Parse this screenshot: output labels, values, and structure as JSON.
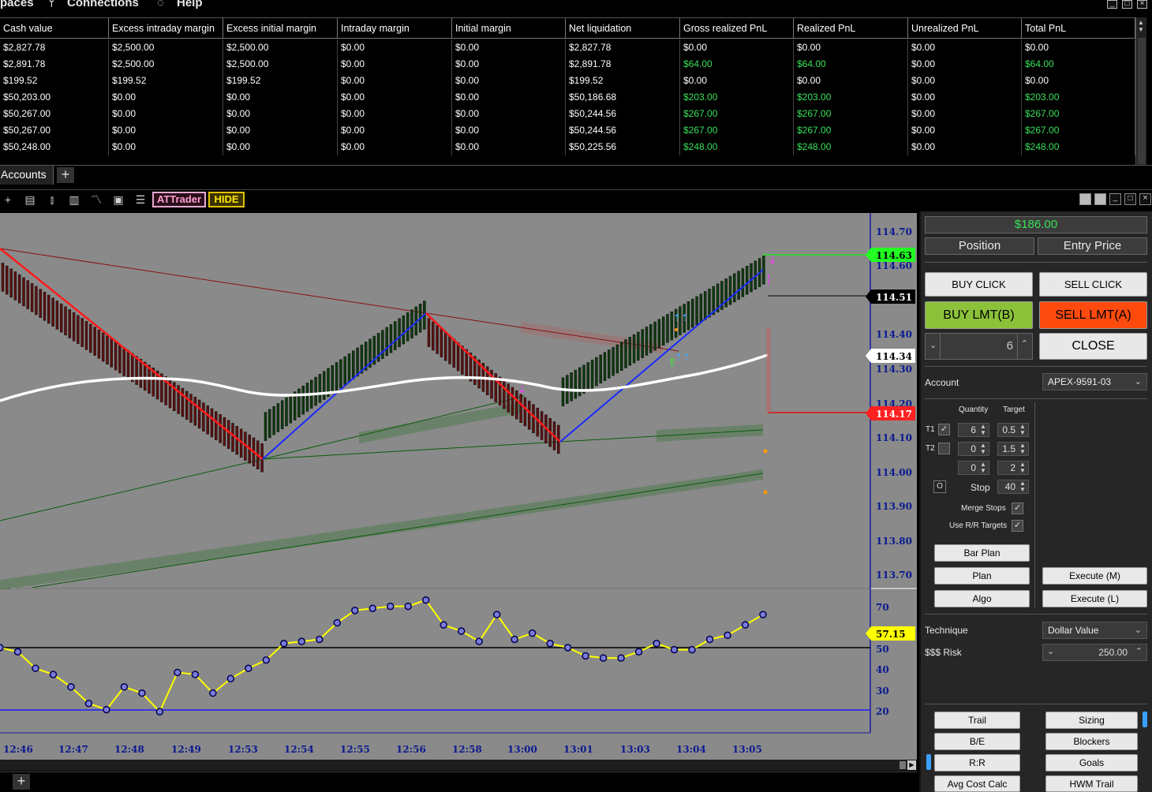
{
  "menu": {
    "items": [
      "paces",
      "Connections",
      "Help"
    ]
  },
  "grid": {
    "columns": [
      "Cash value",
      "Excess intraday margin",
      "Excess initial margin",
      "Intraday margin",
      "Initial margin",
      "Net liquidation",
      "Gross realized PnL",
      "Realized PnL",
      "Unrealized PnL",
      "Total PnL"
    ],
    "rows": [
      [
        "$2,827.78",
        "$2,500.00",
        "$2,500.00",
        "$0.00",
        "$0.00",
        "$2,827.78",
        "$0.00",
        "$0.00",
        "$0.00",
        "$0.00"
      ],
      [
        "$2,891.78",
        "$2,500.00",
        "$2,500.00",
        "$0.00",
        "$0.00",
        "$2,891.78",
        "$64.00",
        "$64.00",
        "$0.00",
        "$64.00"
      ],
      [
        "$199.52",
        "$199.52",
        "$199.52",
        "$0.00",
        "$0.00",
        "$199.52",
        "$0.00",
        "$0.00",
        "$0.00",
        "$0.00"
      ],
      [
        "$50,203.00",
        "$0.00",
        "$0.00",
        "$0.00",
        "$0.00",
        "$50,186.68",
        "$203.00",
        "$203.00",
        "$0.00",
        "$203.00"
      ],
      [
        "$50,267.00",
        "$0.00",
        "$0.00",
        "$0.00",
        "$0.00",
        "$50,244.56",
        "$267.00",
        "$267.00",
        "$0.00",
        "$267.00"
      ],
      [
        "$50,267.00",
        "$0.00",
        "$0.00",
        "$0.00",
        "$0.00",
        "$50,244.56",
        "$267.00",
        "$267.00",
        "$0.00",
        "$267.00"
      ],
      [
        "$50,248.00",
        "$0.00",
        "$0.00",
        "$0.00",
        "$0.00",
        "$50,225.56",
        "$248.00",
        "$248.00",
        "$0.00",
        "$248.00"
      ]
    ],
    "positive_color": "#39e05a"
  },
  "tabs": {
    "accounts": "Accounts",
    "add": "+"
  },
  "toolbar": {
    "attrader": "ATTrader",
    "hide": "HIDE"
  },
  "chart_data": {
    "type": "candlestick",
    "price_axis": [
      "114.70",
      "114.60",
      "114.40",
      "114.30",
      "114.20",
      "114.10",
      "114.00",
      "113.90",
      "113.80",
      "113.70"
    ],
    "price_tags": [
      {
        "value": "114.63",
        "color": "#22ff22",
        "text_color": "#000"
      },
      {
        "value": "114.51",
        "color": "#000000",
        "text_color": "#ffffff"
      },
      {
        "value": "114.34",
        "color": "#ffffff",
        "text_color": "#000"
      },
      {
        "value": "114.17",
        "color": "#ff2020",
        "text_color": "#ffffff"
      }
    ],
    "oscillator_axis": [
      "70",
      "50",
      "40",
      "30",
      "20"
    ],
    "oscillator_tag": "57.15",
    "time_axis": [
      "12:46",
      "12:47",
      "12:48",
      "12:49",
      "12:53",
      "12:54",
      "12:55",
      "12:56",
      "12:58",
      "13:00",
      "13:01",
      "13:03",
      "13:04",
      "13:05"
    ],
    "oscillator_values": [
      50,
      48,
      40,
      37,
      31,
      23,
      20,
      31,
      28,
      19,
      38,
      37,
      28,
      35,
      40,
      44,
      52,
      53,
      54,
      62,
      68,
      69,
      70,
      70,
      73,
      61,
      58,
      53,
      66,
      54,
      57,
      52,
      50,
      46,
      45,
      45,
      48,
      52,
      49,
      49,
      54,
      56,
      61,
      66
    ]
  },
  "panel": {
    "pnl": "$186.00",
    "pnl_color": "#39e05a",
    "position_label": "Position",
    "entry_label": "Entry Price",
    "buy_click": "BUY CLICK",
    "sell_click": "SELL CLICK",
    "buy_lmt": "BUY LMT(B)",
    "sell_lmt": "SELL LMT(A)",
    "qty": "6",
    "close": "CLOSE",
    "account_label": "Account",
    "account_value": "APEX-9591-03",
    "quantity_header": "Quantity",
    "target_header": "Target",
    "t1": "T1",
    "t2": "T2",
    "t1_qty": "6",
    "t1_target": "0.5",
    "t2_qty": "0",
    "t2_target": "1.5",
    "t3_qty": "0",
    "t3_target": "2",
    "stop_label": "Stop",
    "stop_value": "40",
    "o_label": "O",
    "merge_stops": "Merge Stops",
    "use_rr": "Use R/R Targets",
    "bar_plan": "Bar Plan",
    "plan": "Plan",
    "algo": "Algo",
    "execute_m": "Execute (M)",
    "execute_l": "Execute (L)",
    "technique_label": "Technique",
    "technique_value": "Dollar Value",
    "risk_label": "$$$ Risk",
    "risk_value": "250.00",
    "trail": "Trail",
    "sizing": "Sizing",
    "be": "B/E",
    "blockers": "Blockers",
    "rr": "R:R",
    "goals": "Goals",
    "avg_cost": "Avg Cost Calc",
    "hwm_trail": "HWM Trail"
  }
}
